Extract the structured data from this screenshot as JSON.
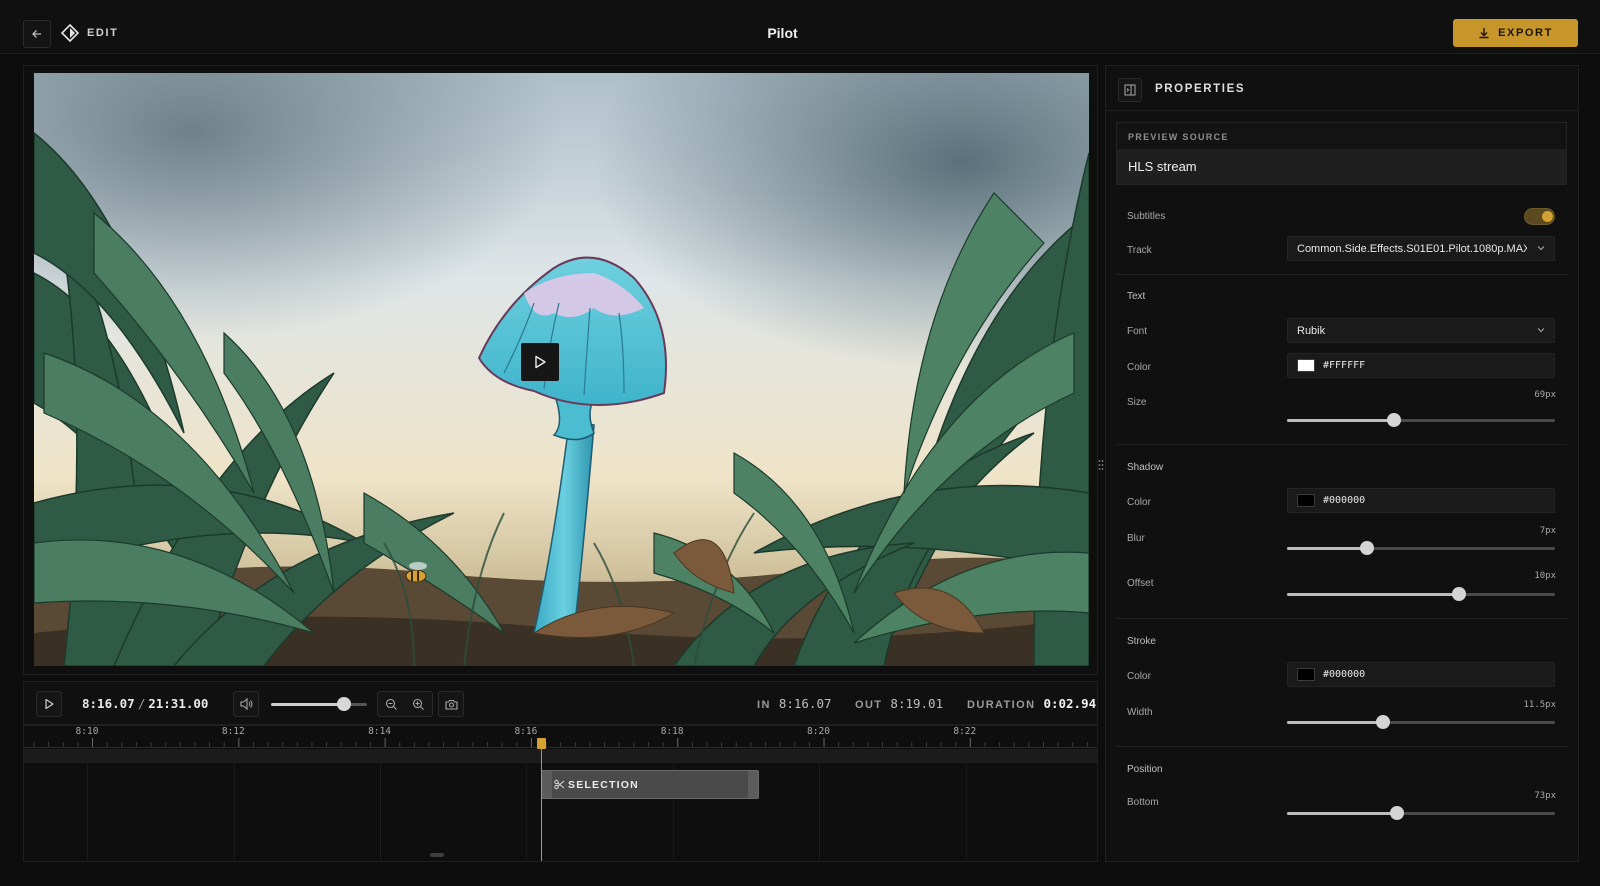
{
  "header": {
    "back_icon": "arrow-left-icon",
    "edit_icon": "diamond-logo-icon",
    "edit_label": "EDIT",
    "title": "Pilot",
    "export_label": "EXPORT",
    "export_icon": "download-icon",
    "accent": "#c7962a"
  },
  "video": {
    "play_icon": "play-icon"
  },
  "controls": {
    "current_time": "8:16.07",
    "separator": "/",
    "total_time": "21:31.00",
    "volume": 0.76,
    "in_label": "IN",
    "in_time": "8:16.07",
    "out_label": "OUT",
    "out_time": "8:19.01",
    "duration_label": "DURATION",
    "duration_value": "0:02.94"
  },
  "timeline": {
    "ticks": [
      "8:10",
      "8:12",
      "8:14",
      "8:16",
      "8:18",
      "8:20",
      "8:22"
    ],
    "selection_label": "SELECTION",
    "selection_icon": "scissors-icon"
  },
  "properties": {
    "title": "PROPERTIES",
    "preview_source_label": "PREVIEW SOURCE",
    "preview_source_value": "HLS stream",
    "subtitles_label": "Subtitles",
    "subtitles_on": true,
    "track_label": "Track",
    "track_value": "Common.Side.Effects.S01E01.Pilot.1080p.MAX",
    "text_section": "Text",
    "font_label": "Font",
    "font_value": "Rubik",
    "text_color_label": "Color",
    "text_color": "#FFFFFF",
    "size_label": "Size",
    "size_value": "69px",
    "size_level": 0.4,
    "shadow_section": "Shadow",
    "shadow_color_label": "Color",
    "shadow_color": "#000000",
    "blur_label": "Blur",
    "blur_value": "7px",
    "blur_level": 0.3,
    "offset_label": "Offset",
    "offset_value": "10px",
    "offset_level": 0.64,
    "stroke_section": "Stroke",
    "stroke_color_label": "Color",
    "stroke_color": "#000000",
    "width_label": "Width",
    "width_value": "11.5px",
    "width_level": 0.36,
    "position_section": "Position",
    "bottom_label": "Bottom",
    "bottom_value": "73px",
    "bottom_level": 0.41
  }
}
